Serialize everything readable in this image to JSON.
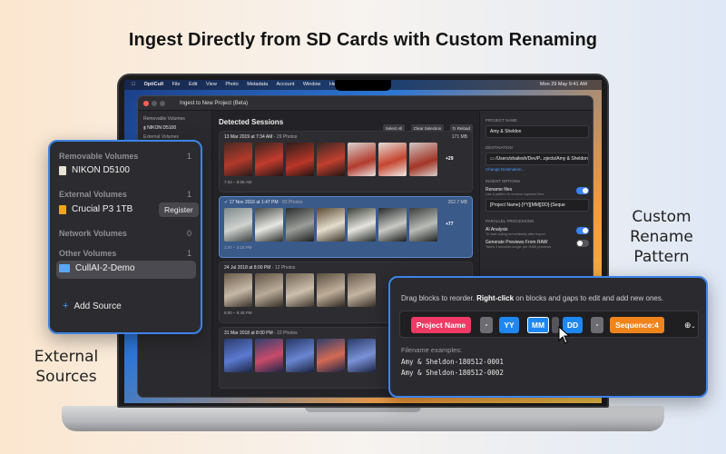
{
  "headline": "Ingest Directly from SD Cards with Custom Renaming",
  "callouts": {
    "custom_rename": "Custom\nRename\nPattern",
    "external_sources": "External\nSources"
  },
  "menubar": {
    "app": "OptiCull",
    "items": [
      "File",
      "Edit",
      "View",
      "Photo",
      "Metadata",
      "Account",
      "Window",
      "Help"
    ],
    "clock": "Mon 29 May 9:41 AM"
  },
  "window": {
    "title": "Ingest to New Project (Beta)",
    "sidebar": {
      "removable_label": "Removable Volumes",
      "device": "NIKON D5100",
      "external_label": "External Volumes"
    },
    "content": {
      "title": "Detected Sessions",
      "buttons": [
        "Select All",
        "Clear Selection",
        "Reload"
      ],
      "sessions": [
        {
          "date": "13 Mar 2019 at 7:34 AM",
          "count": "29 Photos",
          "size": "171 MB",
          "range": "7:34 – 8:55 AM",
          "more": "+29"
        },
        {
          "date": "17 Nov 2016 at 1:47 PM",
          "count": "83 Photos",
          "size": "262.7 MB",
          "range": "1:47 – 3:16 PM",
          "more": "+77"
        },
        {
          "date": "24 Jul 2018 at 8:00 PM",
          "count": "12 Photos",
          "size": "",
          "range": "8:00 – 8:45 PM",
          "more": ""
        },
        {
          "date": "31 Mar 2018 at 8:00 PM",
          "count": "22 Photos",
          "size": "",
          "range": "",
          "more": ""
        }
      ]
    },
    "inspector": {
      "project_name_label": "Project Name",
      "project_name": "Amy & Sheldon",
      "destination_label": "Destination",
      "destination_path": "/Users/shailesh/Dev/P...ojects/Amy & Sheldon",
      "change_destination": "Change Destination...",
      "ingest_options_label": "Ingest Options",
      "rename_files": "Rename files",
      "rename_sub": "Use a pattern to rename ingested files",
      "rename_pattern": "[Project Name]-[YY][MM][DD]-[Seque",
      "parallel_label": "Parallel Processing",
      "ai_analysis": "AI Analysis",
      "ai_sub": "To start culling immediately after import",
      "generate_previews": "Generate Previews From RAW",
      "previews_sub": "Takes 3 seconds longer per RAW previews"
    }
  },
  "sources": {
    "removable_label": "Removable Volumes",
    "removable_count": "1",
    "removable_device": "NIKON D5100",
    "external_label": "External Volumes",
    "external_count": "1",
    "external_device": "Crucial P3 1TB",
    "register": "Register",
    "network_label": "Network Volumes",
    "network_count": "0",
    "other_label": "Other Volumes",
    "other_count": "1",
    "other_device": "CullAI-2-Demo",
    "add_source": "Add Source"
  },
  "rename": {
    "hint_prefix": "Drag blocks to reorder. ",
    "hint_bold": "Right-click",
    "hint_suffix": " on blocks and gaps to edit and add new ones.",
    "blocks": {
      "project_name": "Project Name",
      "sep1": "-",
      "yy": "YY",
      "mm": "MM",
      "dd": "DD",
      "sep2": "-",
      "sequence": "Sequence:4"
    },
    "examples_label": "Filename examples:",
    "examples": [
      "Amy & Sheldon-180512-0001",
      "Amy & Sheldon-180512-0002"
    ]
  },
  "colors": {
    "accent": "#3d83e8",
    "block_red": "#ee3a64",
    "block_blue": "#1e88f0",
    "block_orange": "#f0841c",
    "block_gray": "#6c6c72"
  }
}
